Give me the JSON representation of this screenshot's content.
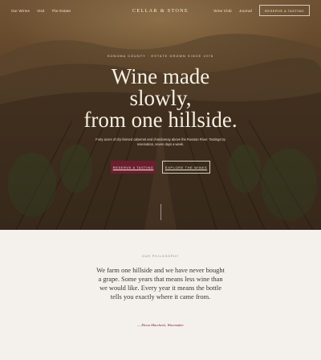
{
  "nav": {
    "links_left": [
      "Our Wines",
      "Visit",
      "The Estate"
    ],
    "brand": "CELLAR & STONE",
    "links_right": [
      "Wine Club",
      "Journal"
    ],
    "cta": "RESERVE A TASTING"
  },
  "hero": {
    "eyebrow": "SONOMA COUNTY · ESTATE GROWN SINCE 1978",
    "headline_lines": [
      "Wine made",
      "slowly,",
      "from one hillside."
    ],
    "lede": "Forty acres of dry-farmed cabernet and chardonnay above the Russian River. Tastings by reservation, seven days a week.",
    "primary_cta": "RESERVE A TASTING",
    "secondary_cta": "EXPLORE THE WINES"
  },
  "philosophy": {
    "eyebrow": "OUR PHILOSOPHY",
    "quote": "We farm one hillside and we have never bought a grape. Some years that means less wine than we would like. Every year it means the bottle tells you exactly where it came from.",
    "attribution": "— Elena Marchetti, Winemaker"
  },
  "colors": {
    "accent": "#6b1f2e",
    "background": "#f4f1ec",
    "hero_text": "#f6efe4",
    "attribution": "#7a2432"
  }
}
